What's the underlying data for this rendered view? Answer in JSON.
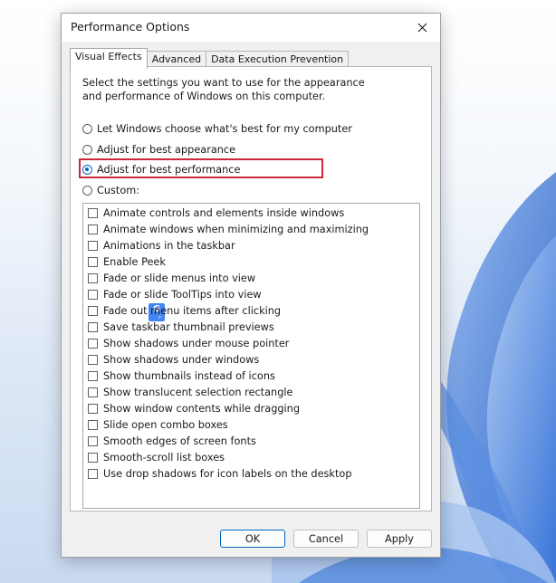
{
  "window": {
    "title": "Performance Options"
  },
  "tabs": [
    {
      "label": "Visual Effects",
      "active": true
    },
    {
      "label": "Advanced",
      "active": false
    },
    {
      "label": "Data Execution Prevention",
      "active": false
    }
  ],
  "description": "Select the settings you want to use for the appearance and performance of Windows on this computer.",
  "radios": [
    {
      "label": "Let Windows choose what's best for my computer",
      "checked": false
    },
    {
      "label": "Adjust for best appearance",
      "checked": false
    },
    {
      "label": "Adjust for best performance",
      "checked": true
    },
    {
      "label": "Custom:",
      "checked": false
    }
  ],
  "effects": [
    {
      "label": "Animate controls and elements inside windows",
      "checked": false
    },
    {
      "label": "Animate windows when minimizing and maximizing",
      "checked": false
    },
    {
      "label": "Animations in the taskbar",
      "checked": false
    },
    {
      "label": "Enable Peek",
      "checked": false
    },
    {
      "label": "Fade or slide menus into view",
      "checked": false
    },
    {
      "label": "Fade or slide ToolTips into view",
      "checked": false
    },
    {
      "label": "Fade out menu items after clicking",
      "checked": false
    },
    {
      "label": "Save taskbar thumbnail previews",
      "checked": false
    },
    {
      "label": "Show shadows under mouse pointer",
      "checked": false
    },
    {
      "label": "Show shadows under windows",
      "checked": false
    },
    {
      "label": "Show thumbnails instead of icons",
      "checked": false
    },
    {
      "label": "Show translucent selection rectangle",
      "checked": false
    },
    {
      "label": "Show window contents while dragging",
      "checked": false
    },
    {
      "label": "Slide open combo boxes",
      "checked": false
    },
    {
      "label": "Smooth edges of screen fonts",
      "checked": false
    },
    {
      "label": "Smooth-scroll list boxes",
      "checked": false
    },
    {
      "label": "Use drop shadows for icon labels on the desktop",
      "checked": false
    }
  ],
  "overlay_badge": "G",
  "buttons": {
    "ok": "OK",
    "cancel": "Cancel",
    "apply": "Apply"
  },
  "colors": {
    "accent": "#0067c0",
    "highlight": "#d0263a",
    "wallpaper_blue": "#2f6fd6"
  },
  "icons": {
    "close": "close-icon",
    "overlay": "translate-badge-icon"
  }
}
